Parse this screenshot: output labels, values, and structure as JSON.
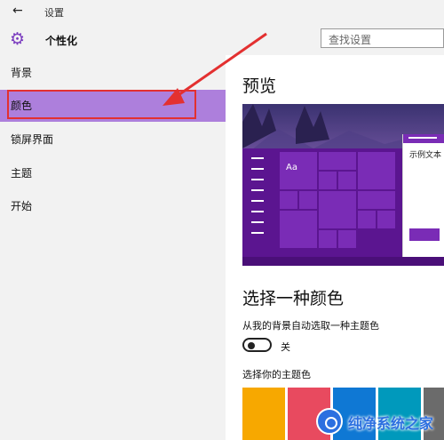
{
  "window": {
    "title": "设置",
    "back_icon": "back-arrow-icon"
  },
  "header": {
    "icon": "gear-icon",
    "title": "个性化",
    "search_placeholder": "查找设置"
  },
  "sidebar": {
    "items": [
      {
        "label": "背景",
        "active": false
      },
      {
        "label": "颜色",
        "active": true
      },
      {
        "label": "锁屏界面",
        "active": false
      },
      {
        "label": "主题",
        "active": false
      },
      {
        "label": "开始",
        "active": false
      }
    ],
    "active_color": "#ad7fdc"
  },
  "content": {
    "preview_heading": "预览",
    "preview": {
      "tile_text": "Aa",
      "window_text": "示例文本"
    },
    "color_heading": "选择一种颜色",
    "auto_pick_label": "从我的背景自动选取一种主题色",
    "toggle": {
      "state": "off",
      "label": "关"
    },
    "pick_label": "选择你的主题色",
    "swatches": [
      "#f7a800",
      "#e84a5f",
      "#0f78d4",
      "#0099bc",
      "#6b6b6b"
    ]
  },
  "annotation": {
    "highlight_color": "#e33030"
  },
  "watermark": {
    "text": "纯净系统之家",
    "brand_color": "#2b6fe0"
  }
}
